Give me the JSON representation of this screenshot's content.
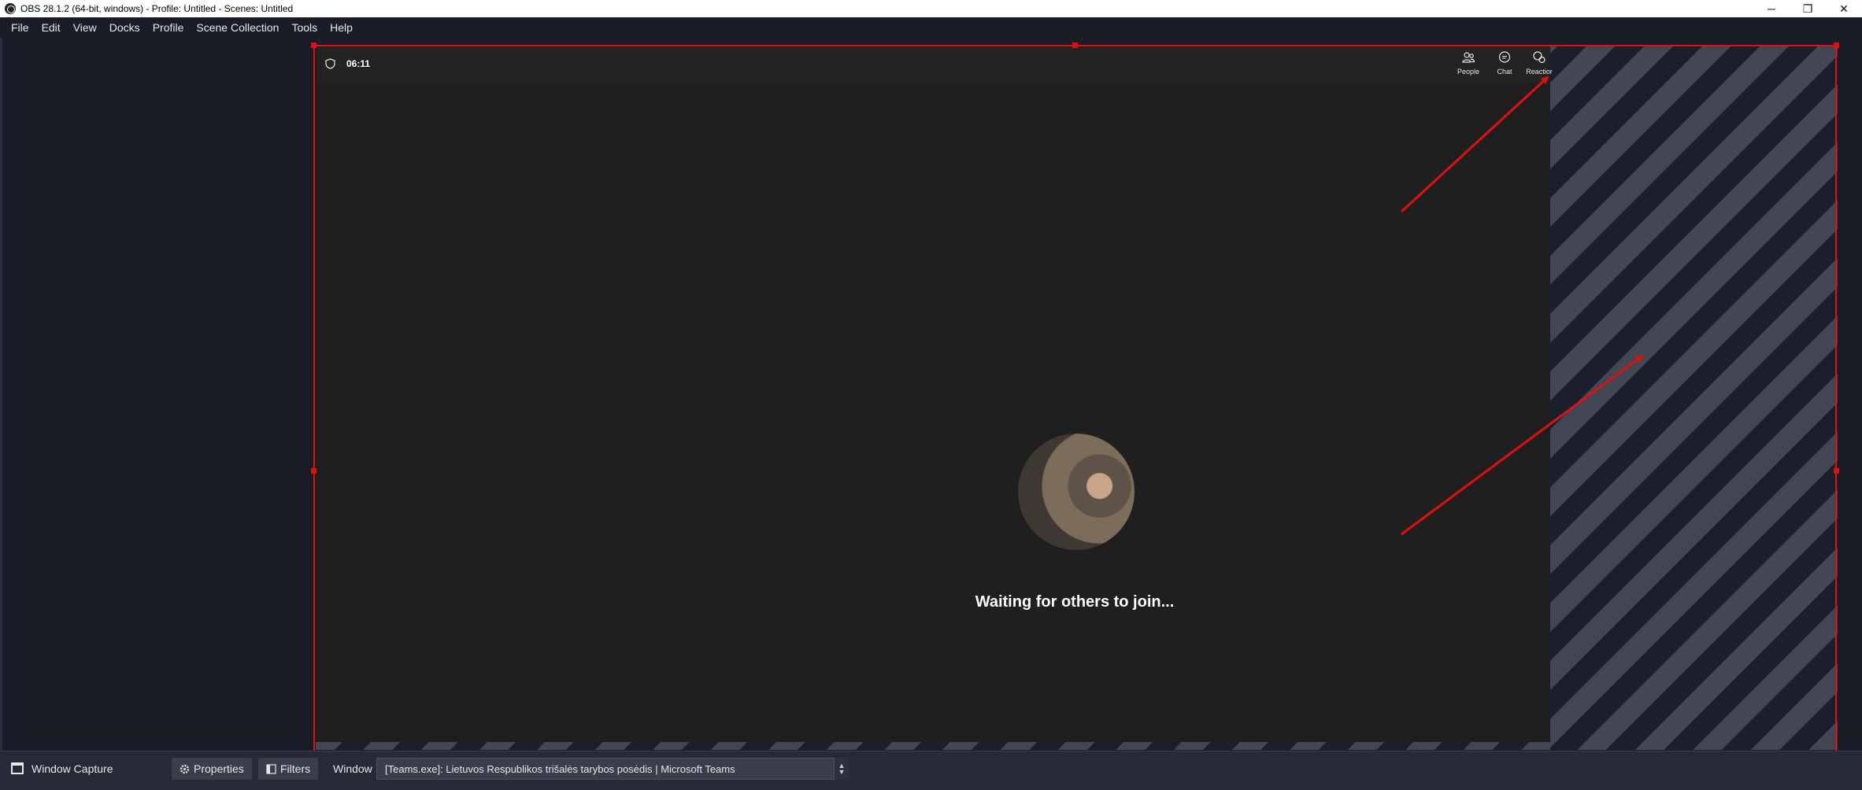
{
  "window": {
    "title": "OBS 28.1.2 (64-bit, windows) - Profile: Untitled - Scenes: Untitled",
    "controls": {
      "minimize": "─",
      "restore": "❐",
      "close": "✕"
    }
  },
  "menu": {
    "items": [
      "File",
      "Edit",
      "View",
      "Docks",
      "Profile",
      "Scene Collection",
      "Tools",
      "Help"
    ]
  },
  "teams": {
    "timer": "06:11",
    "buttons": [
      {
        "label": "People",
        "icon": "people-icon"
      },
      {
        "label": "Chat",
        "icon": "chat-icon"
      },
      {
        "label": "Reactior",
        "icon": "reactions-icon"
      }
    ],
    "waiting_text": "Waiting for others to join..."
  },
  "toolbar": {
    "source_name": "Window Capture",
    "properties_label": "Properties",
    "filters_label": "Filters",
    "window_label": "Window",
    "window_value": "[Teams.exe]: Lietuvos Respublikos trišalės tarybos posėdis | Microsoft Teams"
  },
  "colors": {
    "selection": "#e01010",
    "annotation_arrow": "#e01010",
    "background": "#1a1d28"
  }
}
